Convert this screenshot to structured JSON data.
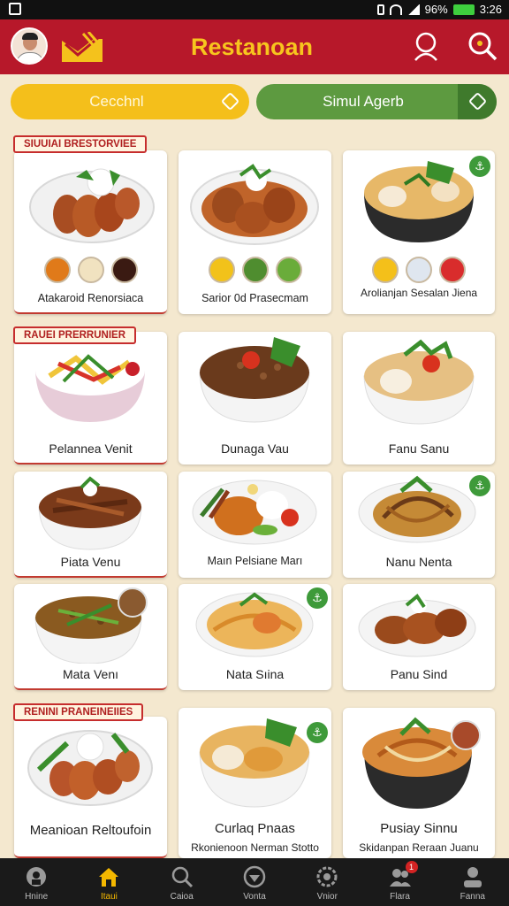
{
  "status": {
    "battery": "96%",
    "time": "3:26"
  },
  "header": {
    "title": "Restanoan",
    "colors": {
      "bar": "#b7182a",
      "title": "#f7c51e"
    }
  },
  "filters": {
    "left_label": "Cecchnl",
    "right_label": "Simul Agerb"
  },
  "sections": [
    {
      "tag": "SIUUIAI BRESTORVIEE"
    },
    {
      "tag": "RAUEI PRERRUNIER"
    },
    {
      "tag": "RENINI PRANEINEIIES"
    }
  ],
  "cards": [
    {
      "name": "Atakaroid Renorsiaca"
    },
    {
      "name": "Sarior 0d Prasecmam"
    },
    {
      "name": "Arolianjan Sesalan Jiena"
    },
    {
      "name": "Pelannea Venit"
    },
    {
      "name": "Dunaga Vau"
    },
    {
      "name": "Fanu Sanu"
    },
    {
      "name": "Piata Venu"
    },
    {
      "name": "Maın Pelsiane Marı"
    },
    {
      "name": "Nanu Nenta"
    },
    {
      "name": "Mata Venı"
    },
    {
      "name": "Nata Sıina"
    },
    {
      "name": "Panu Sind"
    },
    {
      "name": "Meanioan Reltoufoin"
    },
    {
      "name": "Curlaq Pnaas",
      "sub": "Rkonienoon Nerman Stotto"
    },
    {
      "name": "Pusiay Sinnu",
      "sub": "Skidanpan Reraan Juanu"
    }
  ],
  "badge_glyph": "⚓",
  "nav": [
    {
      "label": "Hnine",
      "icon": "home-outline-icon"
    },
    {
      "label": "Itaui",
      "icon": "home-icon",
      "active": true
    },
    {
      "label": "Caioa",
      "icon": "search-icon"
    },
    {
      "label": "Vonta",
      "icon": "compass-icon"
    },
    {
      "label": "Vnior",
      "icon": "settings-icon"
    },
    {
      "label": "Flara",
      "icon": "people-icon",
      "badge": "1"
    },
    {
      "label": "Fanna",
      "icon": "profile-icon"
    }
  ]
}
